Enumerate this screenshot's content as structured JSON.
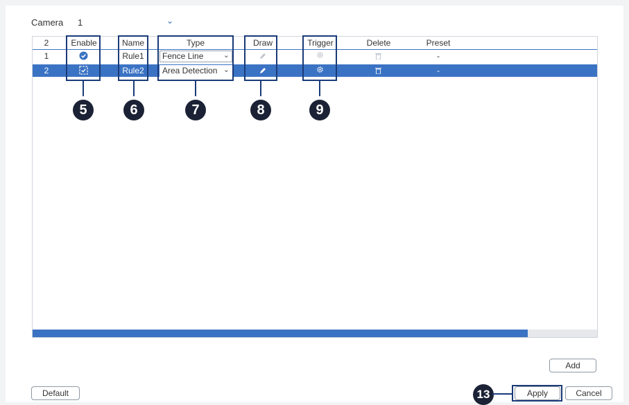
{
  "camera": {
    "label": "Camera",
    "value": "1"
  },
  "table": {
    "headers": [
      "2",
      "Enable",
      "Name",
      "Type",
      "Draw",
      "Trigger",
      "Delete",
      "Preset"
    ],
    "rows": [
      {
        "index": "1",
        "name": "Rule1",
        "type": "Fence Line",
        "preset": "-",
        "selected": false
      },
      {
        "index": "2",
        "name": "Rule2",
        "type": "Area Detection",
        "preset": "-",
        "selected": true
      }
    ]
  },
  "callouts": [
    "5",
    "6",
    "7",
    "8",
    "9",
    "13"
  ],
  "buttons": {
    "add": "Add",
    "default": "Default",
    "apply": "Apply",
    "cancel": "Cancel"
  },
  "colors": {
    "accent": "#3b73c4",
    "callout": "#1a3a78",
    "badge": "#1b2235"
  },
  "icons": {
    "enable_checked": "check-circle-icon",
    "enable_box": "checkbox-icon",
    "draw": "pencil-icon",
    "trigger": "gear-icon",
    "delete": "trash-icon",
    "dropdown": "chevron-down-icon"
  }
}
